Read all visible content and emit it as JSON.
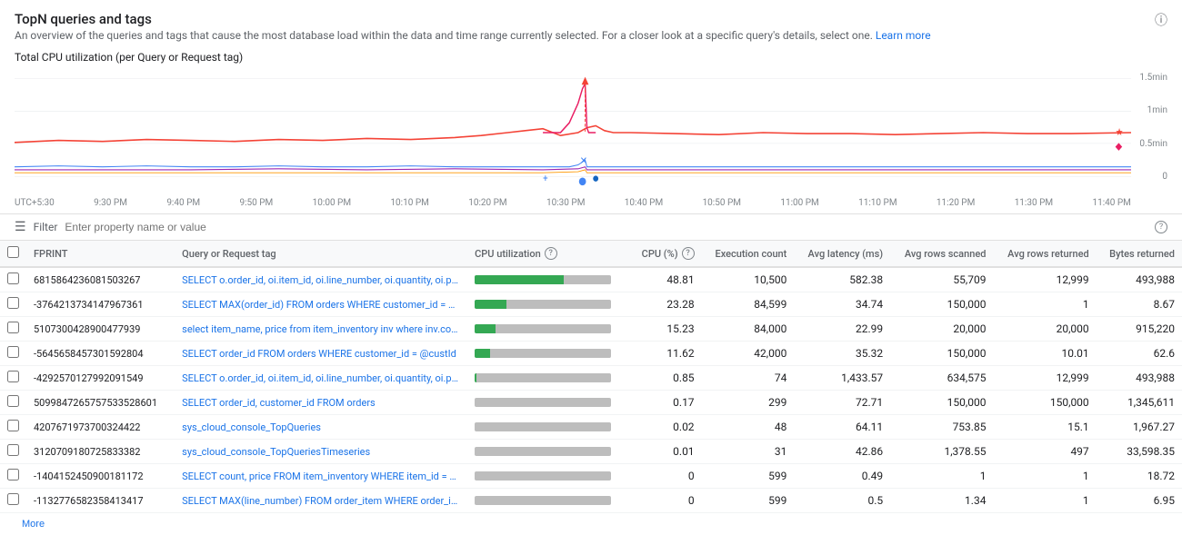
{
  "header": {
    "title": "TopN queries and tags",
    "description": "An overview of the queries and tags that cause the most database load within the data and time range currently selected. For a closer look at a specific query's details, select one.",
    "learn_more": "Learn more",
    "info_icon": "ℹ"
  },
  "section_title": "Total CPU utilization (per Query or Request tag)",
  "chart": {
    "y_labels": [
      "1.5min",
      "1min",
      "0.5min",
      "0"
    ],
    "x_labels": [
      "UTC+5:30",
      "9:30 PM",
      "9:40 PM",
      "9:50 PM",
      "10:00 PM",
      "10:10 PM",
      "10:20 PM",
      "10:30 PM",
      "10:40 PM",
      "10:50 PM",
      "11:00 PM",
      "11:10 PM",
      "11:20 PM",
      "11:30 PM",
      "11:40 PM"
    ]
  },
  "filter": {
    "placeholder": "Enter property name or value",
    "icon": "≡"
  },
  "table": {
    "columns": [
      {
        "id": "checkbox",
        "label": ""
      },
      {
        "id": "fprint",
        "label": "FPRINT"
      },
      {
        "id": "query",
        "label": "Query or Request tag"
      },
      {
        "id": "cpu_util",
        "label": "CPU utilization",
        "has_help": true
      },
      {
        "id": "cpu_pct",
        "label": "CPU (%)",
        "has_help": true
      },
      {
        "id": "exec_count",
        "label": "Execution count"
      },
      {
        "id": "avg_latency",
        "label": "Avg latency (ms)"
      },
      {
        "id": "avg_rows_scanned",
        "label": "Avg rows scanned"
      },
      {
        "id": "avg_rows_returned",
        "label": "Avg rows returned"
      },
      {
        "id": "bytes_returned",
        "label": "Bytes returned"
      }
    ],
    "rows": [
      {
        "fprint": "6815864236081503267",
        "query": "SELECT o.order_id, oi.item_id, oi.line_number, oi.quantity, oi.price, ...",
        "cpu_bar_green": 65,
        "cpu_bar_gray": 35,
        "cpu_pct": "48.81",
        "exec_count": "10,500",
        "avg_latency": "582.38",
        "avg_rows_scanned": "55,709",
        "avg_rows_returned": "12,999",
        "bytes_returned": "493,988"
      },
      {
        "fprint": "-3764213734147967361",
        "query": "SELECT MAX(order_id) FROM orders WHERE customer_id = @cid",
        "cpu_bar_green": 23,
        "cpu_bar_gray": 77,
        "cpu_pct": "23.28",
        "exec_count": "84,599",
        "avg_latency": "34.74",
        "avg_rows_scanned": "150,000",
        "avg_rows_returned": "1",
        "bytes_returned": "8.67"
      },
      {
        "fprint": "5107300428900477939",
        "query": "select item_name, price from item_inventory inv where inv.count > ...",
        "cpu_bar_green": 15,
        "cpu_bar_gray": 85,
        "cpu_pct": "15.23",
        "exec_count": "84,000",
        "avg_latency": "22.99",
        "avg_rows_scanned": "20,000",
        "avg_rows_returned": "20,000",
        "bytes_returned": "915,220"
      },
      {
        "fprint": "-5645658457301592804",
        "query": "SELECT order_id FROM orders WHERE customer_id = @custId",
        "cpu_bar_green": 11,
        "cpu_bar_gray": 89,
        "cpu_pct": "11.62",
        "exec_count": "42,000",
        "avg_latency": "35.32",
        "avg_rows_scanned": "150,000",
        "avg_rows_returned": "10.01",
        "bytes_returned": "62.6"
      },
      {
        "fprint": "-4292570127992091549",
        "query": "SELECT o.order_id, oi.item_id, oi.line_number, oi.quantity, oi.price, ...",
        "cpu_bar_green": 1,
        "cpu_bar_gray": 99,
        "cpu_pct": "0.85",
        "exec_count": "74",
        "avg_latency": "1,433.57",
        "avg_rows_scanned": "634,575",
        "avg_rows_returned": "12,999",
        "bytes_returned": "493,988"
      },
      {
        "fprint": "5099847265757533528601",
        "query": "SELECT order_id, customer_id FROM orders",
        "cpu_bar_green": 0,
        "cpu_bar_gray": 100,
        "cpu_pct": "0.17",
        "exec_count": "299",
        "avg_latency": "72.71",
        "avg_rows_scanned": "150,000",
        "avg_rows_returned": "150,000",
        "bytes_returned": "1,345,611"
      },
      {
        "fprint": "4207671973700324422",
        "query": "sys_cloud_console_TopQueries",
        "cpu_bar_green": 0,
        "cpu_bar_gray": 100,
        "cpu_pct": "0.02",
        "exec_count": "48",
        "avg_latency": "64.11",
        "avg_rows_scanned": "753.85",
        "avg_rows_returned": "15.1",
        "bytes_returned": "1,967.27"
      },
      {
        "fprint": "3120709180725833382",
        "query": "sys_cloud_console_TopQueriesTimeseries",
        "cpu_bar_green": 0,
        "cpu_bar_gray": 100,
        "cpu_pct": "0.01",
        "exec_count": "31",
        "avg_latency": "42.86",
        "avg_rows_scanned": "1,378.55",
        "avg_rows_returned": "497",
        "bytes_returned": "33,598.35"
      },
      {
        "fprint": "-1404152450900181172",
        "query": "SELECT count, price FROM item_inventory WHERE item_id = @id",
        "cpu_bar_green": 0,
        "cpu_bar_gray": 100,
        "cpu_pct": "0",
        "exec_count": "599",
        "avg_latency": "0.49",
        "avg_rows_scanned": "1",
        "avg_rows_returned": "1",
        "bytes_returned": "18.72"
      },
      {
        "fprint": "-1132776582358413417",
        "query": "SELECT MAX(line_number) FROM order_item WHERE order_id = ...",
        "cpu_bar_green": 0,
        "cpu_bar_gray": 100,
        "cpu_pct": "0",
        "exec_count": "599",
        "avg_latency": "0.5",
        "avg_rows_scanned": "1.34",
        "avg_rows_returned": "1",
        "bytes_returned": "6.95"
      }
    ]
  },
  "more_button": "More"
}
